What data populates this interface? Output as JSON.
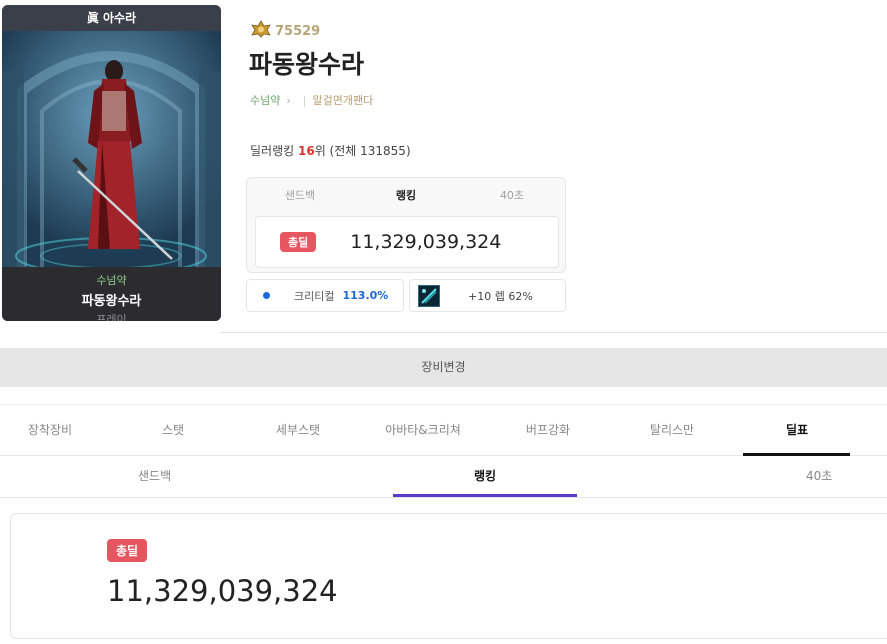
{
  "character": {
    "job_title": "眞 아수라",
    "adventure": "수넘약",
    "name": "파동왕수라",
    "server": "프레이"
  },
  "profile": {
    "fame": "75529",
    "name": "파동왕수라",
    "adventure_link": "수넘약",
    "guild": "말걸면개팬다",
    "rank_prefix": "딜러랭킹",
    "rank_value": "16",
    "rank_suffix": "위 (전체 131855)"
  },
  "rank_box": {
    "tabs": [
      "샌드백",
      "랭킹",
      "40초"
    ],
    "active_tab": 1,
    "badge": "총딜",
    "damage": "11,329,039,324"
  },
  "stats": {
    "critical_label": "크리티컬",
    "critical_value": "113.0%",
    "weapon_text": "+10 렙 62%"
  },
  "equip_change": "장비변경",
  "main_tabs": [
    "장착장비",
    "스탯",
    "세부스탯",
    "아바타&크리쳐",
    "버프강화",
    "탈리스만",
    "딜표"
  ],
  "main_active": 6,
  "sub_tabs": [
    "샌드백",
    "랭킹",
    "40초"
  ],
  "sub_active": 1,
  "summary": {
    "badge": "총딜",
    "damage": "11,329,039,324"
  },
  "colors": {
    "accent_purple": "#5a3ccd",
    "badge_red": "#e65660",
    "rank_red": "#d9342c",
    "crit_blue": "#1b68d8",
    "fame_gold": "#b9a57a"
  }
}
